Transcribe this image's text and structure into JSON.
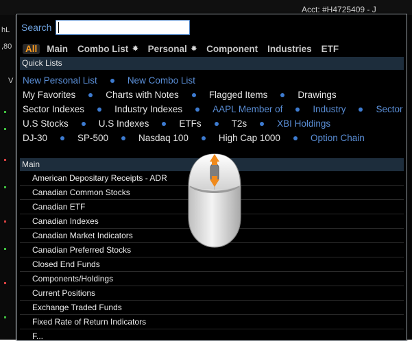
{
  "background": {
    "title": "Acct: #H4725409 - J",
    "strip_labels": [
      "hL",
      ",80",
      "V"
    ]
  },
  "search": {
    "label": "Search",
    "value": "",
    "placeholder": ""
  },
  "tabs": [
    {
      "label": "All",
      "active": true
    },
    {
      "label": "Main"
    },
    {
      "label": "Combo List",
      "star": "✸"
    },
    {
      "label": "Personal",
      "star": "✸"
    },
    {
      "label": "Component"
    },
    {
      "label": "Industries"
    },
    {
      "label": "ETF"
    }
  ],
  "quick_lists": {
    "header": "Quick Lists",
    "rows": [
      [
        {
          "label": "New Personal List",
          "link": true
        },
        {
          "label": "New Combo List",
          "link": true
        }
      ],
      [
        {
          "label": "My Favorites"
        },
        {
          "label": "Charts with Notes"
        },
        {
          "label": "Flagged Items"
        },
        {
          "label": "Drawings"
        }
      ],
      [
        {
          "label": "Sector Indexes"
        },
        {
          "label": "Industry Indexes"
        },
        {
          "label": "AAPL Member of",
          "link": true
        },
        {
          "label": "Industry",
          "link": true
        },
        {
          "label": "Sector",
          "link": true
        }
      ],
      [
        {
          "label": "U.S Stocks"
        },
        {
          "label": "U.S Indexes"
        },
        {
          "label": "ETFs"
        },
        {
          "label": "T2s"
        },
        {
          "label": "XBI Holdings",
          "link": true
        }
      ],
      [
        {
          "label": "DJ-30"
        },
        {
          "label": "SP-500"
        },
        {
          "label": "Nasdaq 100"
        },
        {
          "label": "High Cap 1000"
        },
        {
          "label": "Option Chain",
          "link": true
        }
      ]
    ]
  },
  "main_list": {
    "header": "Main",
    "items": [
      "American Depositary Receipts - ADR",
      "Canadian Common Stocks",
      "Canadian ETF",
      "Canadian Indexes",
      "Canadian Market Indicators",
      "Canadian Preferred Stocks",
      "Closed End Funds",
      "Components/Holdings",
      "Current Positions",
      "Exchange Traded Funds",
      "Fixed Rate of Return Indicators",
      "F..."
    ]
  },
  "colors": {
    "accent_tab": "#ff9d1f",
    "link": "#5a8ed6",
    "bullet": "#3d7bd0",
    "section_header_bg": "#1d2d3c"
  },
  "icons": {
    "overlay": "mouse-scroll-icon"
  }
}
